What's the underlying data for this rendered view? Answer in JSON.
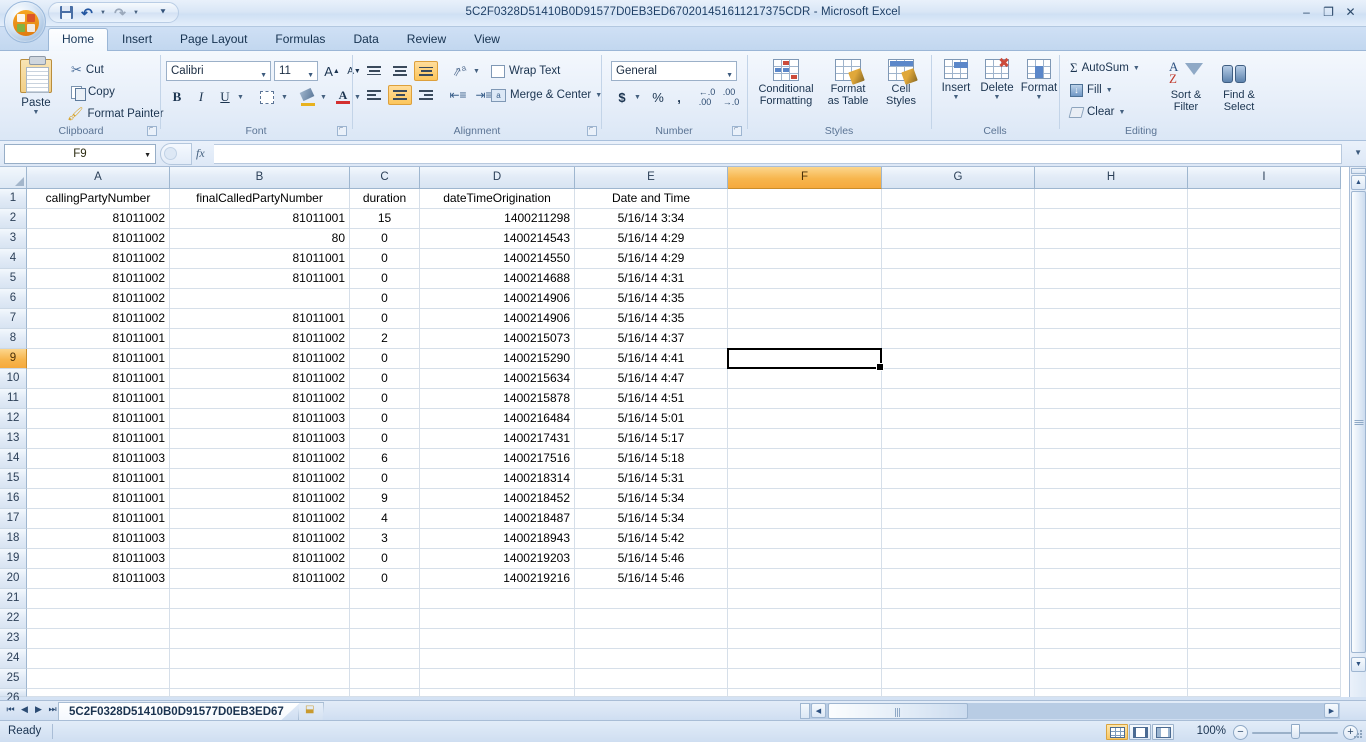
{
  "window": {
    "title": "5C2F0328D51410B0D91577D0EB3ED670201451611217375CDR - Microsoft Excel",
    "minimize": "–",
    "restore": "❐",
    "close": "✕",
    "help": "?"
  },
  "quick_access": {
    "save": "save-icon",
    "undo": "↶",
    "redo": "↷",
    "customize": "☰"
  },
  "tabs": [
    {
      "label": "Home",
      "active": true
    },
    {
      "label": "Insert",
      "active": false
    },
    {
      "label": "Page Layout",
      "active": false
    },
    {
      "label": "Formulas",
      "active": false
    },
    {
      "label": "Data",
      "active": false
    },
    {
      "label": "Review",
      "active": false
    },
    {
      "label": "View",
      "active": false
    }
  ],
  "ribbon": {
    "clipboard": {
      "title": "Clipboard",
      "paste": "Paste",
      "cut": "Cut",
      "copy": "Copy",
      "format_painter": "Format Painter"
    },
    "font": {
      "title": "Font",
      "font_name": "Calibri",
      "font_size": "11",
      "grow_font": "A",
      "shrink_font": "A",
      "bold": "B",
      "italic": "I",
      "underline": "U",
      "borders": "borders-icon",
      "fill_color": "fill-color-icon",
      "font_color": "A"
    },
    "alignment": {
      "title": "Alignment",
      "align_top": "align-top-icon",
      "align_middle": "align-middle-icon",
      "align_bottom": "align-bottom-icon",
      "orientation": "orientation-icon",
      "align_left": "align-left-icon",
      "align_center": "align-center-icon",
      "align_right": "align-right-icon",
      "decrease_indent": "decrease-indent-icon",
      "increase_indent": "increase-indent-icon",
      "wrap_text": "Wrap Text",
      "merge_center": "Merge & Center"
    },
    "number": {
      "title": "Number",
      "format": "General",
      "accounting": "$",
      "percent": "%",
      "comma": ",",
      "increase_decimal": ".00",
      "decrease_decimal": ".00"
    },
    "styles": {
      "title": "Styles",
      "conditional_formatting": [
        "Conditional",
        "Formatting"
      ],
      "format_as_table": [
        "Format",
        "as Table"
      ],
      "cell_styles": [
        "Cell",
        "Styles"
      ]
    },
    "cells": {
      "title": "Cells",
      "insert": "Insert",
      "delete": "Delete",
      "format": "Format"
    },
    "editing": {
      "title": "Editing",
      "autosum": "AutoSum",
      "fill": "Fill",
      "clear": "Clear",
      "sort_filter": [
        "Sort &",
        "Filter"
      ],
      "find_select": [
        "Find &",
        "Select"
      ]
    }
  },
  "formula_bar": {
    "name_box": "F9",
    "fx": "fx",
    "formula_value": ""
  },
  "grid": {
    "column_headers": [
      "A",
      "B",
      "C",
      "D",
      "E",
      "F",
      "G",
      "H",
      "I"
    ],
    "selected_column": "F",
    "selected_row": 9,
    "selected_cell": "F9",
    "row_numbers": [
      1,
      2,
      3,
      4,
      5,
      6,
      7,
      8,
      9,
      10,
      11,
      12,
      13,
      14,
      15,
      16,
      17,
      18,
      19,
      20,
      21,
      22,
      23,
      24,
      25,
      26
    ],
    "header_row": [
      "callingPartyNumber",
      "finalCalledPartyNumber",
      "duration",
      "dateTimeOrigination",
      "Date and Time"
    ],
    "rows": [
      [
        "81011002",
        "81011001",
        "15",
        "1400211298",
        "5/16/14 3:34"
      ],
      [
        "81011002",
        "80",
        "0",
        "1400214543",
        "5/16/14 4:29"
      ],
      [
        "81011002",
        "81011001",
        "0",
        "1400214550",
        "5/16/14 4:29"
      ],
      [
        "81011002",
        "81011001",
        "0",
        "1400214688",
        "5/16/14 4:31"
      ],
      [
        "81011002",
        "",
        "0",
        "1400214906",
        "5/16/14 4:35"
      ],
      [
        "81011002",
        "81011001",
        "0",
        "1400214906",
        "5/16/14 4:35"
      ],
      [
        "81011001",
        "81011002",
        "2",
        "1400215073",
        "5/16/14 4:37"
      ],
      [
        "81011001",
        "81011002",
        "0",
        "1400215290",
        "5/16/14 4:41"
      ],
      [
        "81011001",
        "81011002",
        "0",
        "1400215634",
        "5/16/14 4:47"
      ],
      [
        "81011001",
        "81011002",
        "0",
        "1400215878",
        "5/16/14 4:51"
      ],
      [
        "81011001",
        "81011003",
        "0",
        "1400216484",
        "5/16/14 5:01"
      ],
      [
        "81011001",
        "81011003",
        "0",
        "1400217431",
        "5/16/14 5:17"
      ],
      [
        "81011003",
        "81011002",
        "6",
        "1400217516",
        "5/16/14 5:18"
      ],
      [
        "81011001",
        "81011002",
        "0",
        "1400218314",
        "5/16/14 5:31"
      ],
      [
        "81011001",
        "81011002",
        "9",
        "1400218452",
        "5/16/14 5:34"
      ],
      [
        "81011001",
        "81011002",
        "4",
        "1400218487",
        "5/16/14 5:34"
      ],
      [
        "81011003",
        "81011002",
        "3",
        "1400218943",
        "5/16/14 5:42"
      ],
      [
        "81011003",
        "81011002",
        "0",
        "1400219203",
        "5/16/14 5:46"
      ],
      [
        "81011003",
        "81011002",
        "0",
        "1400219216",
        "5/16/14 5:46"
      ]
    ]
  },
  "sheet_tabs": {
    "first": "⏮",
    "prev": "◀",
    "next": "▶",
    "last": "⏭",
    "active_sheet": "5C2F0328D51410B0D91577D0EB3ED67",
    "insert_sheet": "insert-worksheet-icon"
  },
  "status_bar": {
    "mode": "Ready",
    "view_normal": "normal-view-icon",
    "view_page_layout": "page-layout-view-icon",
    "view_page_break": "page-break-preview-icon",
    "zoom": "100%",
    "zoom_out": "−",
    "zoom_in": "+"
  },
  "colors": {
    "accent_orange": "#f7b64e",
    "ribbon_blue": "#dbe7f6",
    "grid_line": "#d6dfe9"
  }
}
